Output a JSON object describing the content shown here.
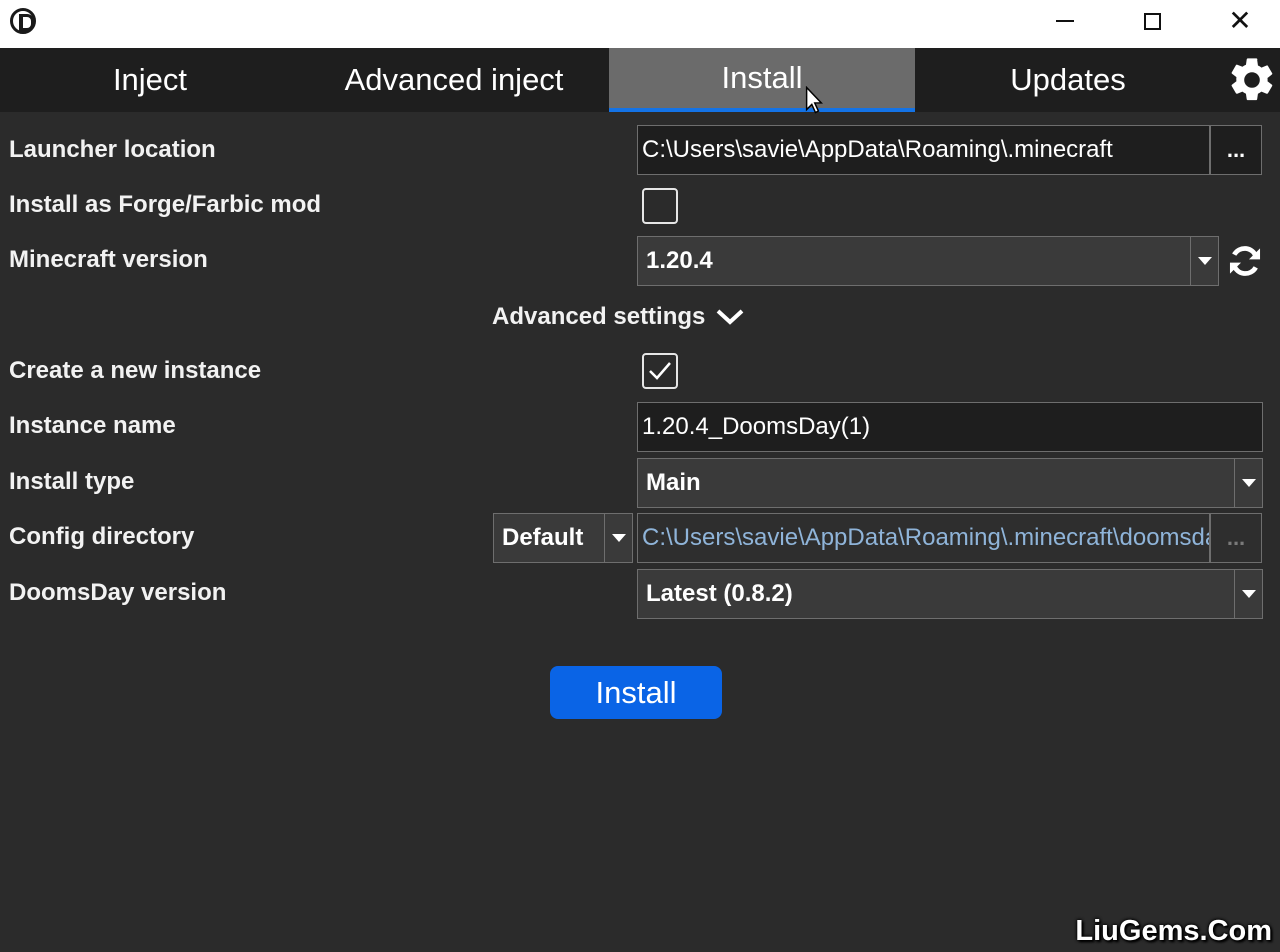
{
  "tabs": [
    {
      "label": "Inject"
    },
    {
      "label": "Advanced inject"
    },
    {
      "label": "Install"
    },
    {
      "label": "Updates"
    }
  ],
  "form": {
    "launcher_location": {
      "label": "Launcher location",
      "value": "C:\\Users\\savie\\AppData\\Roaming\\.minecraft",
      "browse": "..."
    },
    "forge_mod": {
      "label": "Install as Forge/Farbic mod",
      "checked": false
    },
    "minecraft_version": {
      "label": "Minecraft version",
      "value": "1.20.4"
    },
    "advanced_settings": {
      "label": "Advanced settings"
    },
    "new_instance": {
      "label": "Create a new instance",
      "checked": true
    },
    "instance_name": {
      "label": "Instance name",
      "value": "1.20.4_DoomsDay(1)"
    },
    "install_type": {
      "label": "Install type",
      "value": "Main"
    },
    "config_directory": {
      "label": "Config directory",
      "mode": "Default",
      "value": "C:\\Users\\savie\\AppData\\Roaming\\.minecraft\\doomsday",
      "browse": "..."
    },
    "doomsday_version": {
      "label": "DoomsDay version",
      "value": "Latest (0.8.2)"
    }
  },
  "install_button": {
    "label": "Install"
  },
  "watermark": "LiuGems.Com",
  "colors": {
    "accent": "#0a64e6",
    "tab_active": "#6b6b6b",
    "background": "#2b2b2b"
  }
}
